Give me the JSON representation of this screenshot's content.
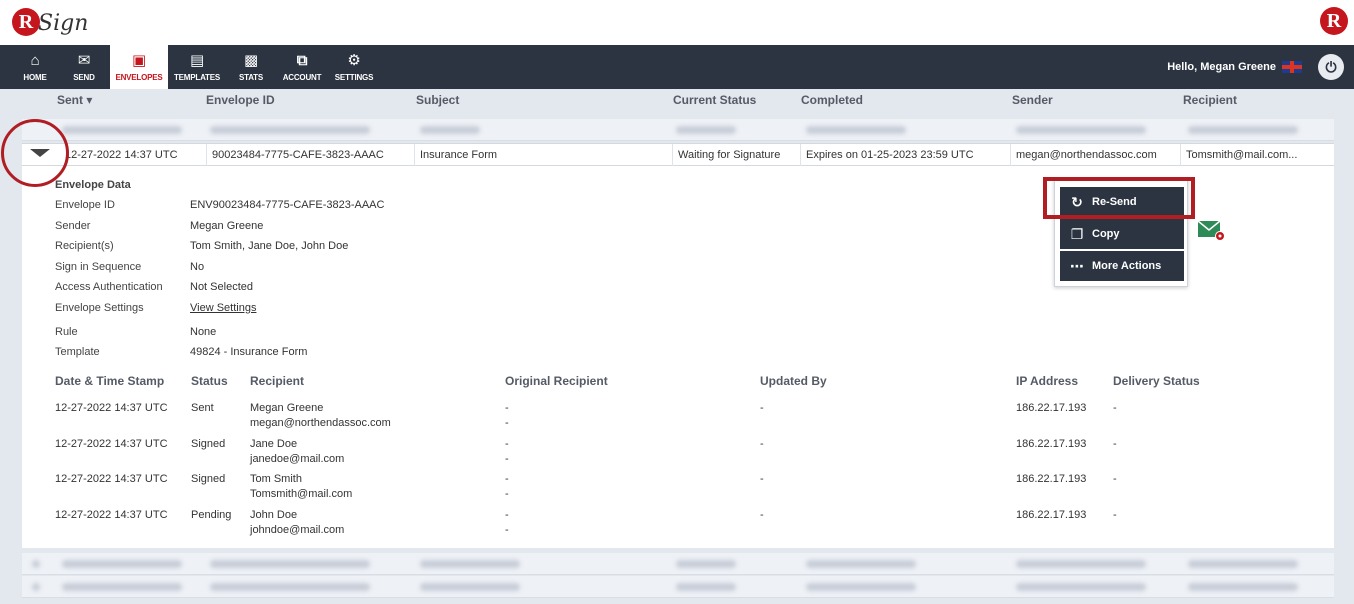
{
  "app": {
    "logo_letter": "R",
    "logo_text": "Sign",
    "right_logo_letter": "R"
  },
  "nav": {
    "items": [
      {
        "label": "HOME",
        "icon": "home-icon"
      },
      {
        "label": "SEND",
        "icon": "envelope-icon"
      },
      {
        "label": "ENVELOPES",
        "icon": "envelopes-box-icon",
        "active": true
      },
      {
        "label": "TEMPLATES",
        "icon": "templates-icon"
      },
      {
        "label": "STATS",
        "icon": "briefcase-icon"
      },
      {
        "label": "ACCOUNT",
        "icon": "account-icon"
      },
      {
        "label": "SETTINGS",
        "icon": "gear-icon"
      }
    ],
    "greeting": "Hello, Megan Greene",
    "power_icon": "power-icon"
  },
  "table": {
    "columns": [
      "Sent",
      "Envelope ID",
      "Subject",
      "Current Status",
      "Completed",
      "Sender",
      "Recipient"
    ],
    "sort_indicator": "▾",
    "selected_row": {
      "sent": "12-27-2022 14:37 UTC",
      "envelope_id": "90023484-7775-CAFE-3823-AAAC",
      "subject": "Insurance Form",
      "status": "Waiting for Signature",
      "completed": "Expires on 01-25-2023 23:59 UTC",
      "sender": "megan@northendassoc.com",
      "recipient": "Tomsmith@mail.com..."
    }
  },
  "detail": {
    "title": "Envelope Data",
    "fields": [
      {
        "label": "Envelope ID",
        "value": "ENV90023484-7775-CAFE-3823-AAAC"
      },
      {
        "label": "Sender",
        "value": "Megan Greene"
      },
      {
        "label": "Recipient(s)",
        "value": "Tom Smith, Jane Doe, John Doe"
      },
      {
        "label": "Sign in Sequence",
        "value": "No"
      },
      {
        "label": "Access Authentication",
        "value": "Not Selected"
      },
      {
        "label": "Envelope Settings",
        "value": "View Settings"
      },
      {
        "label": "Rule",
        "value": "None"
      },
      {
        "label": "Template",
        "value": "49824 - Insurance Form"
      }
    ],
    "history_headers": [
      "Date & Time Stamp",
      "Status",
      "Recipient",
      "Original Recipient",
      "Updated By",
      "IP Address",
      "Delivery Status"
    ],
    "history": [
      {
        "date": "12-27-2022 14:37 UTC",
        "status": "Sent",
        "name": "Megan Greene",
        "email": "megan@northendassoc.com",
        "orig1": "-",
        "orig2": "-",
        "updated": "-",
        "ip": "186.22.17.193",
        "delivery": "-"
      },
      {
        "date": "12-27-2022 14:37 UTC",
        "status": "Signed",
        "name": "Jane Doe",
        "email": "janedoe@mail.com",
        "orig1": "-",
        "orig2": "-",
        "updated": "-",
        "ip": "186.22.17.193",
        "delivery": "-"
      },
      {
        "date": "12-27-2022 14:37 UTC",
        "status": "Signed",
        "name": "Tom Smith",
        "email": "Tomsmith@mail.com",
        "orig1": "-",
        "orig2": "-",
        "updated": "-",
        "ip": "186.22.17.193",
        "delivery": "-"
      },
      {
        "date": "12-27-2022 14:37 UTC",
        "status": "Pending",
        "name": "John Doe",
        "email": "johndoe@mail.com",
        "orig1": "-",
        "orig2": "-",
        "updated": "-",
        "ip": "186.22.17.193",
        "delivery": "-"
      }
    ]
  },
  "actions_menu": {
    "items": [
      {
        "label": "Re-Send",
        "icon": "refresh-icon"
      },
      {
        "label": "Copy",
        "icon": "copy-icon"
      },
      {
        "label": "More Actions",
        "icon": "more-icon"
      }
    ]
  },
  "colors": {
    "brand": "#c4161c",
    "nav_bg": "#2b3440",
    "highlight": "#b01e23"
  }
}
